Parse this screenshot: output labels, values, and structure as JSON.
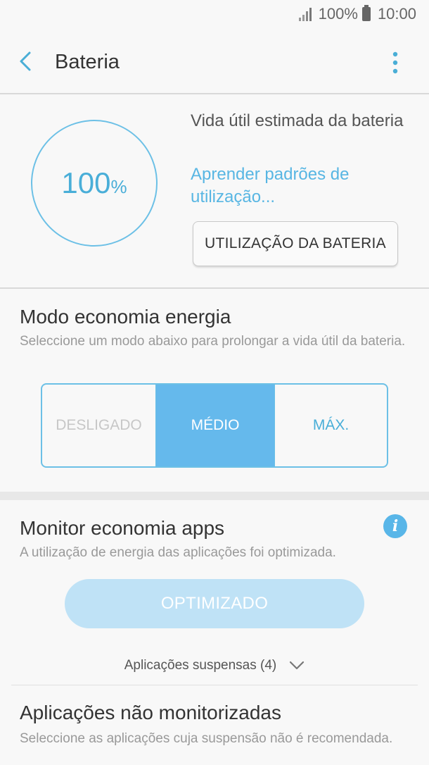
{
  "status_bar": {
    "battery_percent": "100%",
    "time": "10:00"
  },
  "app_bar": {
    "title": "Bateria"
  },
  "battery": {
    "level": "100",
    "level_unit": "%",
    "estimate_label": "Vida útil estimada da bateria",
    "learn_link": "Aprender padrões de utilização...",
    "usage_button": "UTILIZAÇÃO DA BATERIA",
    "ring_color": "#6cc0e6"
  },
  "power_saving": {
    "title": "Modo economia energia",
    "description": "Seleccione um modo abaixo para prolongar a vida útil da bateria.",
    "options": [
      "DESLIGADO",
      "MÉDIO",
      "MÁX."
    ],
    "selected": "MÉDIO",
    "accent": "#65b9ec"
  },
  "app_monitor": {
    "title": "Monitor economia apps",
    "description": "A utilização de energia das aplicações foi optimizada.",
    "button": "OPTIMIZADO",
    "suspended_label": "Aplicações suspensas (4)",
    "info_icon": "i"
  },
  "unmonitored": {
    "title": "Aplicações não monitorizadas",
    "description": "Seleccione as aplicações cuja suspensão não é recomendada."
  }
}
